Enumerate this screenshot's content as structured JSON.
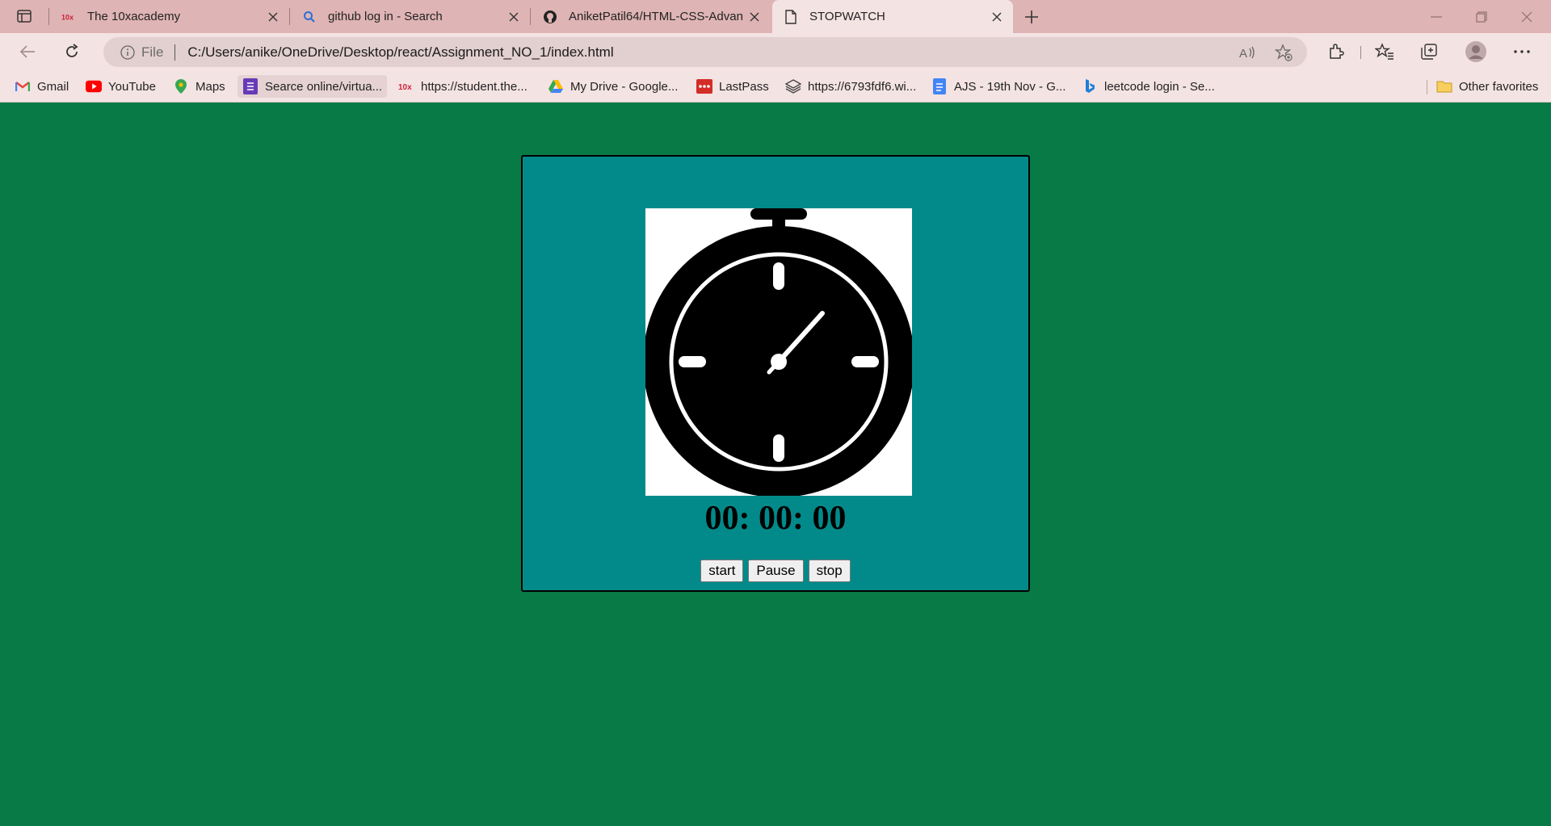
{
  "browser": {
    "tabs": [
      {
        "title": "The 10xacademy",
        "icon": "10x-logo-icon",
        "active": false
      },
      {
        "title": "github log in - Search",
        "icon": "search-icon",
        "active": false
      },
      {
        "title": "AniketPatil64/HTML-CSS-Advanc",
        "icon": "github-icon",
        "active": false
      },
      {
        "title": "STOPWATCH",
        "icon": "page-icon",
        "active": true
      }
    ],
    "address": {
      "scheme": "File",
      "url": "C:/Users/anike/OneDrive/Desktop/react/Assignment_NO_1/index.html"
    },
    "bookmarks": [
      {
        "label": "Gmail",
        "icon": "gmail-icon"
      },
      {
        "label": "YouTube",
        "icon": "youtube-icon"
      },
      {
        "label": "Maps",
        "icon": "maps-icon"
      },
      {
        "label": "Searce online/virtua...",
        "icon": "forms-icon"
      },
      {
        "label": "https://student.the...",
        "icon": "10x-logo-icon"
      },
      {
        "label": "My Drive - Google...",
        "icon": "drive-icon"
      },
      {
        "label": "LastPass",
        "icon": "lastpass-icon"
      },
      {
        "label": "https://6793fdf6.wi...",
        "icon": "layers-icon"
      },
      {
        "label": "AJS - 19th Nov - G...",
        "icon": "docs-icon"
      },
      {
        "label": "leetcode login - Se...",
        "icon": "bing-icon"
      }
    ],
    "other_favorites": "Other favorites"
  },
  "page": {
    "time_display": "00: 00: 00",
    "buttons": {
      "start": "start",
      "pause": "Pause",
      "stop": "stop"
    },
    "colors": {
      "background": "#077a46",
      "panel": "#028a8a"
    }
  }
}
